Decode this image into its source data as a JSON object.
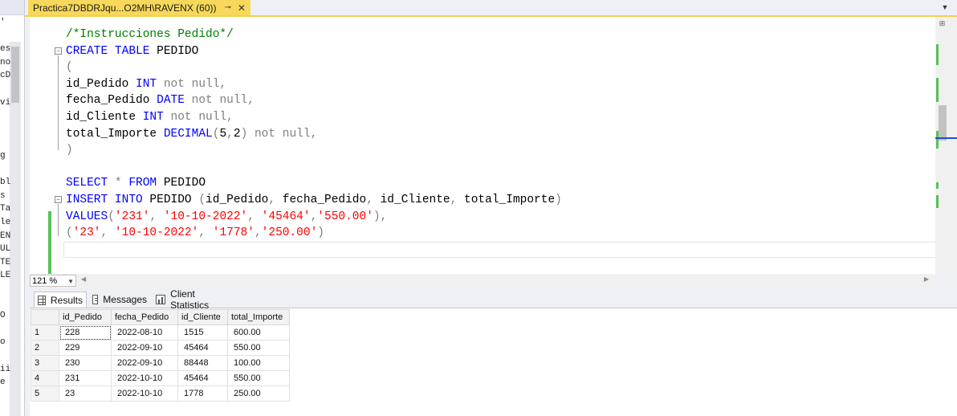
{
  "left_panel": {
    "lines": [
      "'",
      "",
      "es",
      "no",
      "cD",
      "",
      "vi",
      "",
      "",
      "",
      "g",
      "",
      "bl",
      "s",
      "Ta",
      "le",
      "EN",
      "UL",
      "TE",
      "LE",
      "",
      "",
      "O",
      "",
      "o",
      "",
      "ii",
      "e"
    ]
  },
  "tab": {
    "title": "Practica7DBDRJqu...O2MH\\RAVENX (60))",
    "pin": "⊸",
    "close": "✕"
  },
  "editor": {
    "lines": [
      {
        "segs": [
          {
            "c": "cm",
            "t": "/*Instrucciones Pedido*/"
          }
        ]
      },
      {
        "segs": [
          {
            "c": "kw",
            "t": "CREATE TABLE"
          },
          {
            "c": "",
            "t": " PEDIDO"
          }
        ]
      },
      {
        "segs": [
          {
            "c": "gr",
            "t": "("
          }
        ]
      },
      {
        "segs": [
          {
            "c": "",
            "t": "id_Pedido "
          },
          {
            "c": "kw",
            "t": "INT"
          },
          {
            "c": "gr",
            "t": " not null,"
          }
        ]
      },
      {
        "segs": [
          {
            "c": "",
            "t": "fecha_Pedido "
          },
          {
            "c": "kw",
            "t": "DATE"
          },
          {
            "c": "gr",
            "t": " not null,"
          }
        ]
      },
      {
        "segs": [
          {
            "c": "",
            "t": "id_Cliente "
          },
          {
            "c": "kw",
            "t": "INT"
          },
          {
            "c": "gr",
            "t": " not null,"
          }
        ]
      },
      {
        "segs": [
          {
            "c": "",
            "t": "total_Importe "
          },
          {
            "c": "kw",
            "t": "DECIMAL"
          },
          {
            "c": "gr",
            "t": "("
          },
          {
            "c": "",
            "t": "5"
          },
          {
            "c": "gr",
            "t": ","
          },
          {
            "c": "",
            "t": "2"
          },
          {
            "c": "gr",
            "t": ") not null,"
          }
        ]
      },
      {
        "segs": [
          {
            "c": "gr",
            "t": ")"
          }
        ]
      },
      {
        "segs": []
      },
      {
        "segs": [
          {
            "c": "kw",
            "t": "SELECT"
          },
          {
            "c": "",
            "t": " "
          },
          {
            "c": "gr",
            "t": "*"
          },
          {
            "c": "",
            "t": " "
          },
          {
            "c": "kw",
            "t": "FROM"
          },
          {
            "c": "",
            "t": " PEDIDO"
          }
        ]
      },
      {
        "segs": [
          {
            "c": "kw",
            "t": "INSERT INTO"
          },
          {
            "c": "",
            "t": " PEDIDO "
          },
          {
            "c": "gr",
            "t": "("
          },
          {
            "c": "",
            "t": "id_Pedido"
          },
          {
            "c": "gr",
            "t": ","
          },
          {
            "c": "",
            "t": " fecha_Pedido"
          },
          {
            "c": "gr",
            "t": ","
          },
          {
            "c": "",
            "t": " id_Cliente"
          },
          {
            "c": "gr",
            "t": ","
          },
          {
            "c": "",
            "t": " total_Importe"
          },
          {
            "c": "gr",
            "t": ")"
          }
        ]
      },
      {
        "segs": [
          {
            "c": "kw",
            "t": "VALUES"
          },
          {
            "c": "gr",
            "t": "("
          },
          {
            "c": "st",
            "t": "'231'"
          },
          {
            "c": "gr",
            "t": ", "
          },
          {
            "c": "st",
            "t": "'10-10-2022'"
          },
          {
            "c": "gr",
            "t": ", "
          },
          {
            "c": "st",
            "t": "'45464'"
          },
          {
            "c": "gr",
            "t": ","
          },
          {
            "c": "st",
            "t": "'550.00'"
          },
          {
            "c": "gr",
            "t": "),"
          }
        ]
      },
      {
        "segs": [
          {
            "c": "gr",
            "t": "("
          },
          {
            "c": "st",
            "t": "'23'"
          },
          {
            "c": "gr",
            "t": ", "
          },
          {
            "c": "st",
            "t": "'10-10-2022'"
          },
          {
            "c": "gr",
            "t": ", "
          },
          {
            "c": "st",
            "t": "'1778'"
          },
          {
            "c": "gr",
            "t": ","
          },
          {
            "c": "st",
            "t": "'250.00'"
          },
          {
            "c": "gr",
            "t": ")"
          }
        ]
      },
      {
        "segs": []
      }
    ]
  },
  "zoom": {
    "value": "121 %"
  },
  "results_tabs": [
    {
      "label": "Results",
      "icon": "grid-icon",
      "active": true
    },
    {
      "label": "Messages",
      "icon": "messages-icon",
      "active": false
    },
    {
      "label": "Client Statistics",
      "icon": "statistics-icon",
      "active": false
    }
  ],
  "grid": {
    "columns": [
      "id_Pedido",
      "fecha_Pedido",
      "id_Cliente",
      "total_Importe"
    ],
    "rows": [
      {
        "n": "1",
        "cells": [
          "228",
          "2022-08-10",
          "1515",
          "600.00"
        ]
      },
      {
        "n": "2",
        "cells": [
          "229",
          "2022-09-10",
          "45464",
          "550.00"
        ]
      },
      {
        "n": "3",
        "cells": [
          "230",
          "2022-09-10",
          "88448",
          "100.00"
        ]
      },
      {
        "n": "4",
        "cells": [
          "231",
          "2022-10-10",
          "45464",
          "550.00"
        ]
      },
      {
        "n": "5",
        "cells": [
          "23",
          "2022-10-10",
          "1778",
          "250.00"
        ]
      }
    ]
  },
  "colors": {
    "tab_active": "#f8d85a",
    "keyword": "#0000ff",
    "string": "#ff0000",
    "comment": "#008000",
    "change_bar": "#57c157"
  }
}
